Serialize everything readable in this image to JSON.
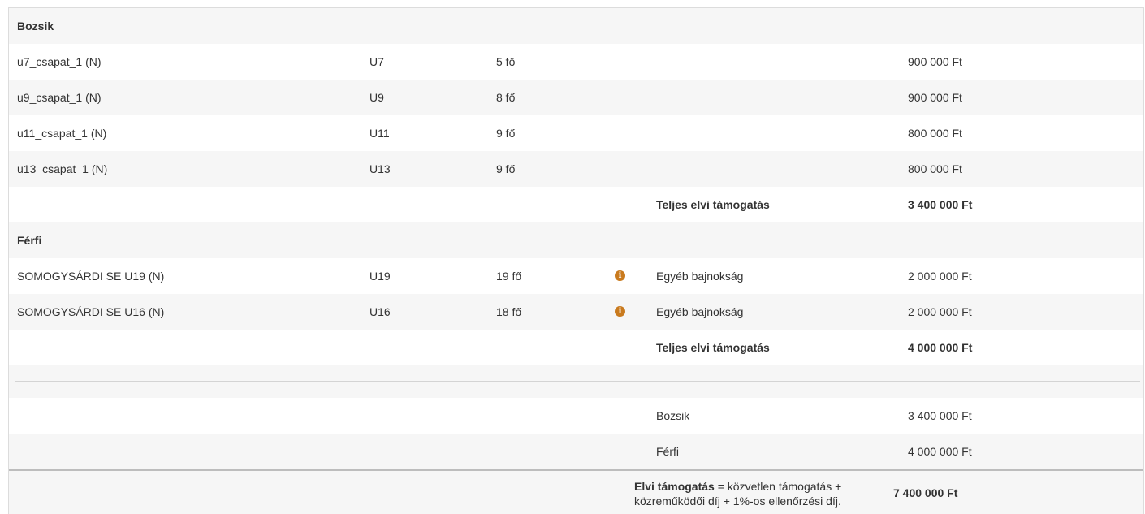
{
  "sections": [
    {
      "title": "Bozsik",
      "rows": [
        {
          "name": "u7_csapat_1 (N)",
          "age": "U7",
          "count": "5 fő",
          "type": "",
          "amount": "900 000 Ft"
        },
        {
          "name": "u9_csapat_1 (N)",
          "age": "U9",
          "count": "8 fő",
          "type": "",
          "amount": "900 000 Ft"
        },
        {
          "name": "u11_csapat_1 (N)",
          "age": "U11",
          "count": "9 fő",
          "type": "",
          "amount": "800 000 Ft"
        },
        {
          "name": "u13_csapat_1 (N)",
          "age": "U13",
          "count": "9 fő",
          "type": "",
          "amount": "800 000 Ft"
        }
      ],
      "subtotal_label": "Teljes elvi támogatás",
      "subtotal_amount": "3 400 000 Ft"
    },
    {
      "title": "Férfi",
      "rows": [
        {
          "name": "SOMOGYSÁRDI SE U19 (N)",
          "age": "U19",
          "count": "19 fő",
          "type": "Egyéb bajnokság",
          "amount": "2 000 000 Ft",
          "info_icon": "info-circle-icon"
        },
        {
          "name": "SOMOGYSÁRDI SE U16 (N)",
          "age": "U16",
          "count": "18 fő",
          "type": "Egyéb bajnokság",
          "amount": "2 000 000 Ft",
          "info_icon": "info-circle-icon"
        }
      ],
      "subtotal_label": "Teljes elvi támogatás",
      "subtotal_amount": "4 000 000 Ft"
    }
  ],
  "summary": [
    {
      "label": "Bozsik",
      "amount": "3 400 000 Ft"
    },
    {
      "label": "Férfi",
      "amount": "4 000 000 Ft"
    }
  ],
  "grand_total": {
    "label_bold": "Elvi támogatás",
    "label_rest_line1": " = közvetlen támogatás +",
    "label_line2": "közreműködői díj + 1%-os ellenőrzési díj.",
    "amount": "7 400 000 Ft"
  },
  "colors": {
    "info_icon": "#c97a1e",
    "row_alt": "#f6f6f6"
  }
}
